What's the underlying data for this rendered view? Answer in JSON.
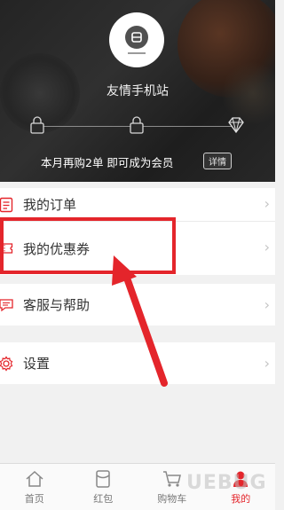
{
  "header": {
    "site_name": "友情手机站",
    "vip_text": "本月再购2单 即可成为会员",
    "detail_label": "详情",
    "progress_icons": [
      "lock-icon",
      "lock-icon",
      "diamond-icon"
    ]
  },
  "menu": {
    "items": [
      {
        "label": "我的订单",
        "icon": "order-icon"
      },
      {
        "label": "我的优惠券",
        "icon": "coupon-icon"
      },
      {
        "label": "客服与帮助",
        "icon": "chat-icon"
      },
      {
        "label": "设置",
        "icon": "gear-icon"
      }
    ],
    "arrow": "›"
  },
  "tabbar": {
    "tabs": [
      {
        "label": "首页",
        "icon": "home-icon"
      },
      {
        "label": "红包",
        "icon": "redpacket-icon"
      },
      {
        "label": "购物车",
        "icon": "cart-icon"
      },
      {
        "label": "我的",
        "icon": "user-icon"
      }
    ]
  },
  "watermark": "UEBUG",
  "colors": {
    "accent": "#e4252b",
    "header_bg": "#262626"
  }
}
